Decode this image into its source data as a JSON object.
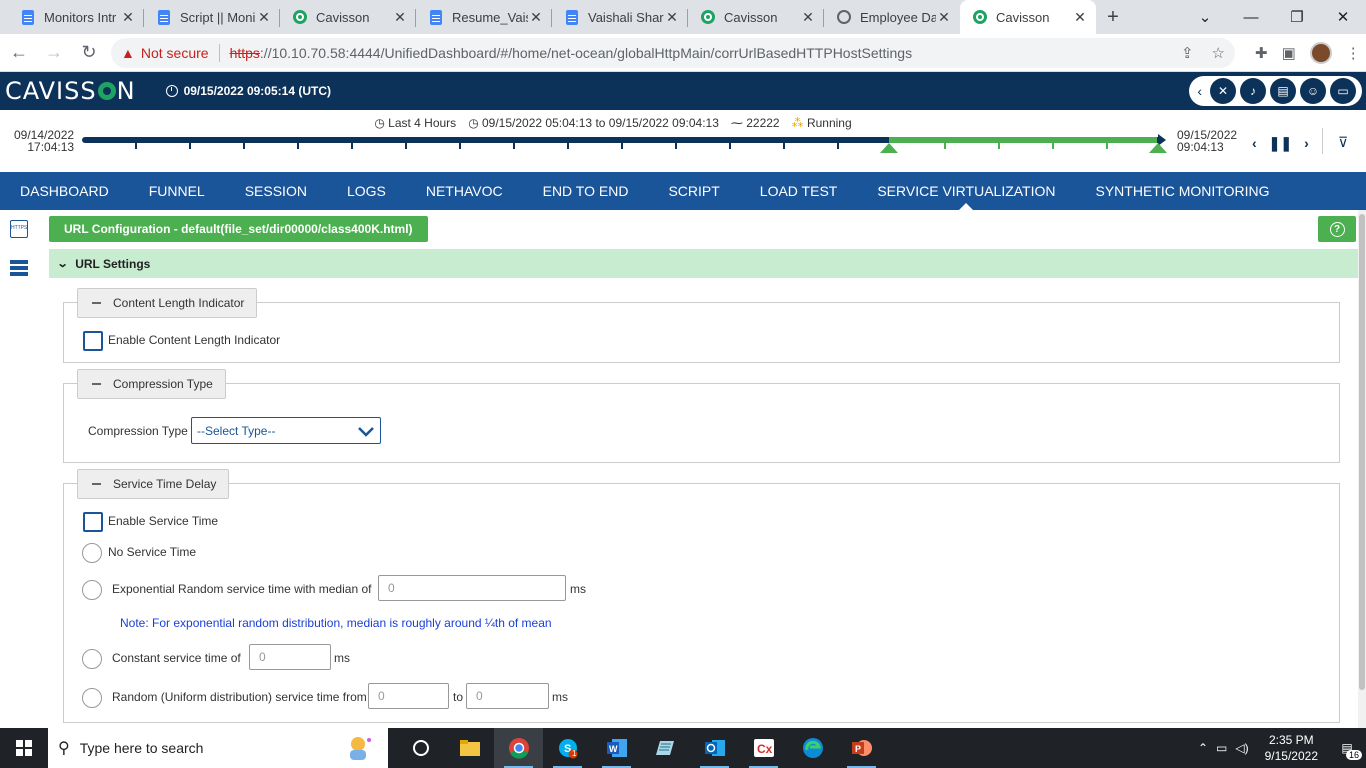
{
  "browser": {
    "tabs": [
      {
        "title": "Monitors Intr",
        "icon": "docs-icon"
      },
      {
        "title": "Script || Moni",
        "icon": "docs-icon"
      },
      {
        "title": "Cavisson",
        "icon": "cavisson-icon"
      },
      {
        "title": "Resume_Vaish",
        "icon": "docs-icon"
      },
      {
        "title": "Vaishali Sharm",
        "icon": "docs-icon"
      },
      {
        "title": "Cavisson",
        "icon": "cavisson-icon"
      },
      {
        "title": "Employee Da",
        "icon": "globe-icon"
      },
      {
        "title": "Cavisson",
        "icon": "cavisson-icon",
        "active": true
      }
    ],
    "security_label": "Not secure",
    "url_scheme": "https",
    "url_rest": "://10.10.70.58:4444/UnifiedDashboard/#/home/net-ocean/globalHttpMain/corrUrlBasedHTTPHostSettings"
  },
  "app": {
    "logo_left": "CAVISS",
    "logo_right": "N",
    "datetime": "09/15/2022 09:05:14 (UTC)"
  },
  "timeline": {
    "range_label": "Last 4 Hours",
    "range_detail": "09/15/2022 05:04:13 to 09/15/2022 09:04:13",
    "test_id": "22222",
    "status": "Running",
    "start_date": "09/14/2022",
    "start_time": "17:04:13",
    "end_date": "09/15/2022",
    "end_time": "09:04:13"
  },
  "nav": {
    "items": [
      "DASHBOARD",
      "FUNNEL",
      "SESSION",
      "LOGS",
      "NETHAVOC",
      "END TO END",
      "SCRIPT",
      "LOAD TEST",
      "SERVICE VIRTUALIZATION",
      "SYNTHETIC MONITORING"
    ],
    "active": "SERVICE VIRTUALIZATION"
  },
  "rail": {
    "https_icon_text": "HTTPS"
  },
  "page": {
    "config_title": "URL Configuration - default(file_set/dir00000/class400K.html)",
    "section_title": "URL Settings",
    "content_length": {
      "legend": "Content Length Indicator",
      "checkbox_label": "Enable Content Length Indicator"
    },
    "compression": {
      "legend": "Compression Type",
      "label": "Compression Type",
      "selected": "--Select Type--"
    },
    "service_time": {
      "legend": "Service Time Delay",
      "enable_label": "Enable Service Time",
      "no_service_label": "No Service Time",
      "exponential_label": "Exponential Random service time with median of",
      "exponential_placeholder": "0",
      "unit_ms": "ms",
      "note": "Note: For exponential random distribution, median is roughly around ¼th of mean",
      "constant_label": "Constant service time of",
      "constant_placeholder": "0",
      "random_label": "Random (Uniform distribution) service time from",
      "random_from_placeholder": "0",
      "to_label": "to",
      "random_to_placeholder": "0"
    }
  },
  "taskbar": {
    "search_placeholder": "Type here to search",
    "time": "2:35 PM",
    "date": "9/15/2022",
    "notification_count": "16",
    "skype_badge": "1"
  },
  "colors": {
    "header_bg": "#0d3259",
    "nav_bg": "#1a5499",
    "accent_green": "#4caf50",
    "section_bg": "#c8ecd0"
  }
}
